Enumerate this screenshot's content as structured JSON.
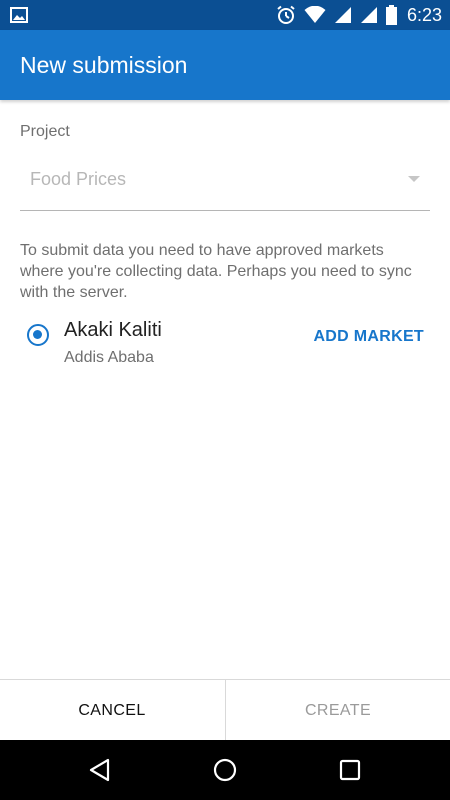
{
  "status_bar": {
    "time": "6:23",
    "icons": [
      "image-notification-icon",
      "alarm-icon",
      "wifi-icon",
      "signal-icon",
      "signal-icon",
      "battery-icon"
    ]
  },
  "app_bar": {
    "title": "New submission"
  },
  "form": {
    "project_label": "Project",
    "project_value": "Food Prices",
    "info_text": "To submit data you need to have approved markets where you're collecting data. Perhaps you need to sync with the server.",
    "market": {
      "name": "Akaki Kaliti",
      "city": "Addis Ababa",
      "selected": true
    },
    "add_market_label": "ADD MARKET"
  },
  "actions": {
    "cancel_label": "CANCEL",
    "create_label": "CREATE"
  },
  "nav_bar": {
    "icons": [
      "back-icon",
      "home-icon",
      "recents-icon"
    ]
  },
  "colors": {
    "status_bar": "#0b4f93",
    "app_bar": "#1776cb",
    "accent": "#1776cb"
  }
}
